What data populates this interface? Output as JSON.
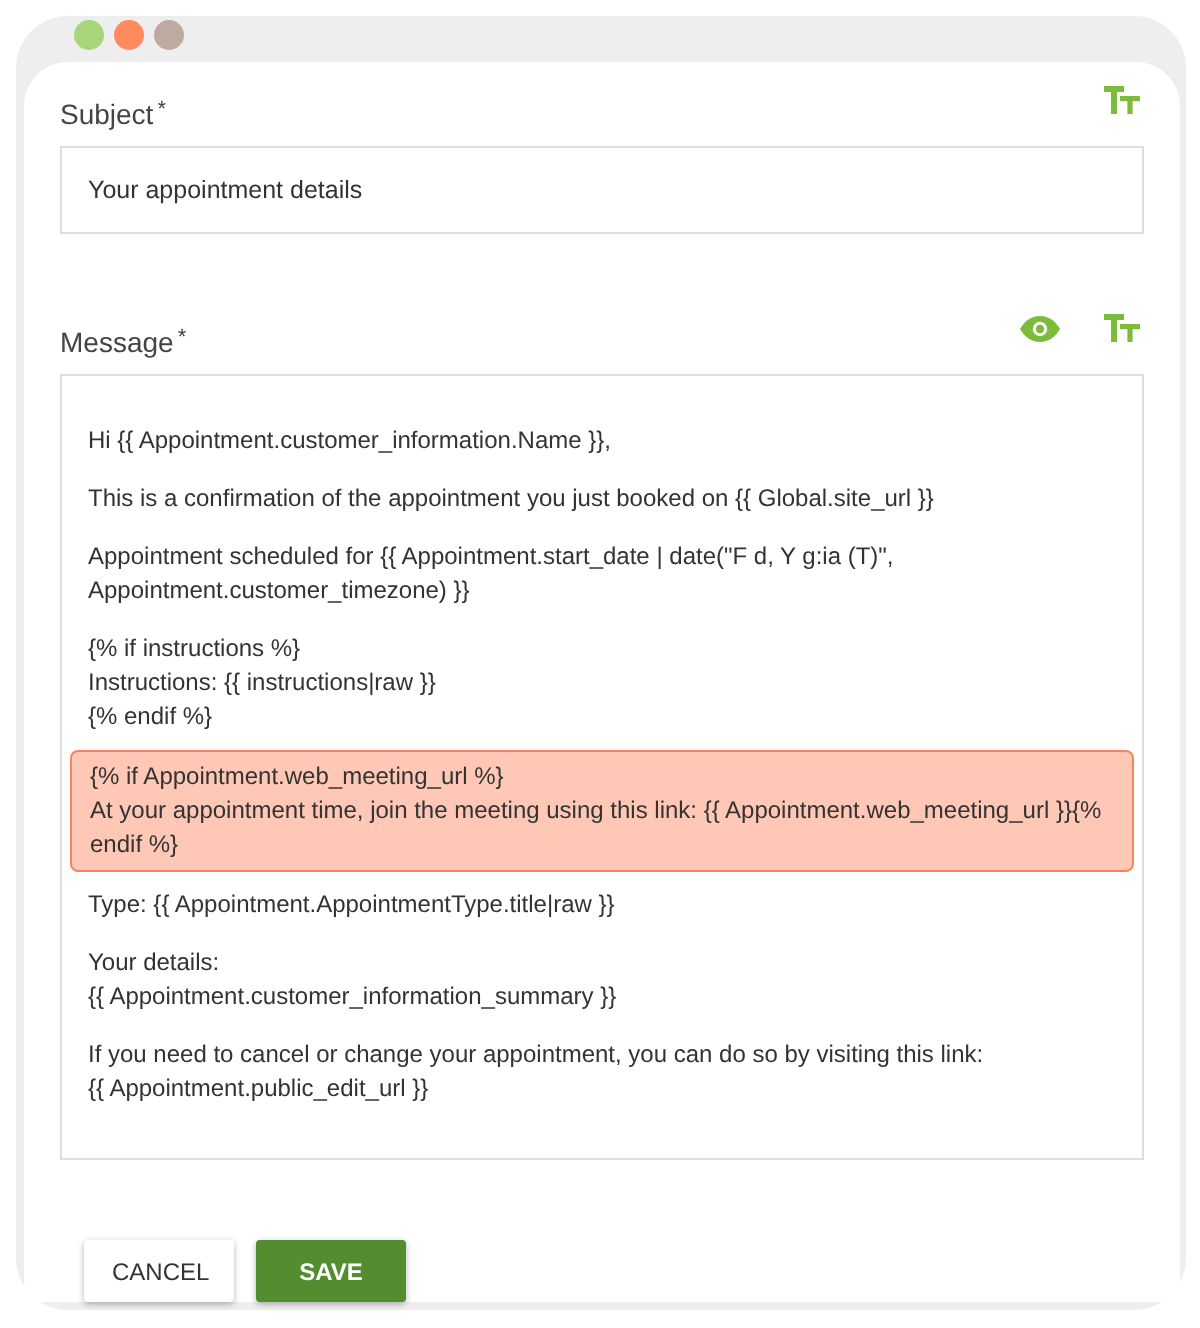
{
  "window": {
    "dots": [
      {
        "color": "#a8d47a"
      },
      {
        "color": "#ff8a5e"
      },
      {
        "color": "#bfaaa2"
      }
    ]
  },
  "subject": {
    "label": "Subject",
    "required_mark": "*",
    "value": "Your appointment details"
  },
  "message": {
    "label": "Message",
    "required_mark": "*",
    "paragraphs": [
      {
        "text": "Hi {{ Appointment.customer_information.Name }},",
        "highlighted": false
      },
      {
        "text": "This is a confirmation of the appointment you just booked on {{ Global.site_url }}",
        "highlighted": false
      },
      {
        "text": "Appointment scheduled for {{ Appointment.start_date | date(\"F d, Y g:ia (T)\",\nAppointment.customer_timezone) }}",
        "highlighted": false
      },
      {
        "text": "{% if instructions %}\nInstructions: {{ instructions|raw }}\n{% endif %}",
        "highlighted": false
      },
      {
        "text": "{% if Appointment.web_meeting_url %}\nAt your appointment time, join the meeting using this link: {{ Appointment.web_meeting_url }}{% endif %}",
        "highlighted": true
      },
      {
        "text": "Type: {{ Appointment.AppointmentType.title|raw }}",
        "highlighted": false
      },
      {
        "text": "Your details:\n{{ Appointment.customer_information_summary }}",
        "highlighted": false
      },
      {
        "text": "If you need to cancel or change your appointment, you can do so by visiting this link:\n{{ Appointment.public_edit_url }}",
        "highlighted": false
      }
    ]
  },
  "buttons": [
    {
      "label": "CANCEL",
      "kind": "secondary"
    },
    {
      "label": "SAVE",
      "kind": "primary"
    }
  ]
}
